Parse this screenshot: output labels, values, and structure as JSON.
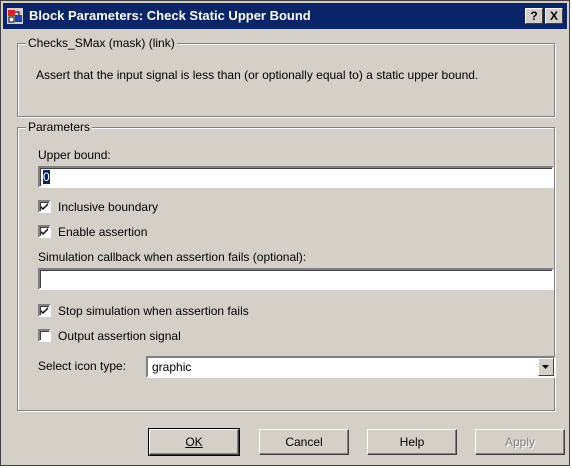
{
  "window": {
    "title": "Block Parameters: Check Static  Upper Bound",
    "help_glyph": "?",
    "close_glyph": "X"
  },
  "description_group": {
    "legend": "Checks_SMax (mask) (link)",
    "text": "Assert that the input signal is less than (or optionally equal to) a static upper bound."
  },
  "parameters_group": {
    "legend": "Parameters",
    "upper_bound_label": "Upper bound:",
    "upper_bound_value": "0",
    "inclusive_boundary": {
      "label": "Inclusive boundary",
      "checked": true
    },
    "enable_assertion": {
      "label": "Enable assertion",
      "checked": true
    },
    "callback_label": "Simulation callback when assertion fails (optional):",
    "callback_value": "",
    "stop_simulation": {
      "label": "Stop simulation when assertion fails",
      "checked": true
    },
    "output_signal": {
      "label": "Output assertion signal",
      "checked": false
    },
    "icon_type_label": "Select icon type:",
    "icon_type_value": "graphic"
  },
  "buttons": {
    "ok": "OK",
    "cancel": "Cancel",
    "help": "Help",
    "apply": "Apply"
  },
  "colors": {
    "titlebar": "#0a246a",
    "dialog_face": "#d4d0c8"
  },
  "icons": [
    "simulink-block-icon",
    "help-icon",
    "close-icon",
    "checkmark-icon",
    "dropdown-arrow-icon"
  ]
}
